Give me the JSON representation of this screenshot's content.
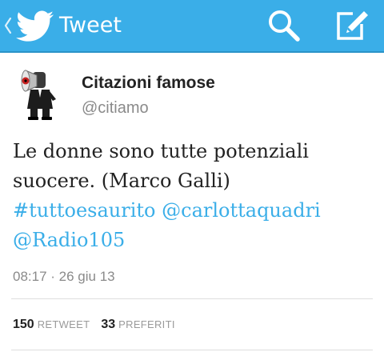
{
  "actionbar": {
    "title": "Tweet",
    "icons": {
      "back": "chevron-left-icon",
      "logo": "twitter-bird-icon",
      "search": "search-icon",
      "compose": "compose-icon"
    },
    "color": "#3aaee8"
  },
  "author": {
    "name": "Citazioni famose",
    "handle": "@citiamo",
    "avatar_icon": "megaphone-man-avatar"
  },
  "tweet": {
    "text_plain": "Le donne sono tutte potenziali suocere. (Marco Galli)",
    "hashtag": "#tuttoesaurito",
    "mention_1": "@carlottaquadri",
    "mention_2": "@Radio105",
    "link_color": "#3aaee8",
    "timestamp": "08:17 · 26 giu 13"
  },
  "stats": {
    "retweet_count": "150",
    "retweet_label": "RETWEET",
    "favorite_count": "33",
    "favorite_label": "PREFERITI"
  }
}
